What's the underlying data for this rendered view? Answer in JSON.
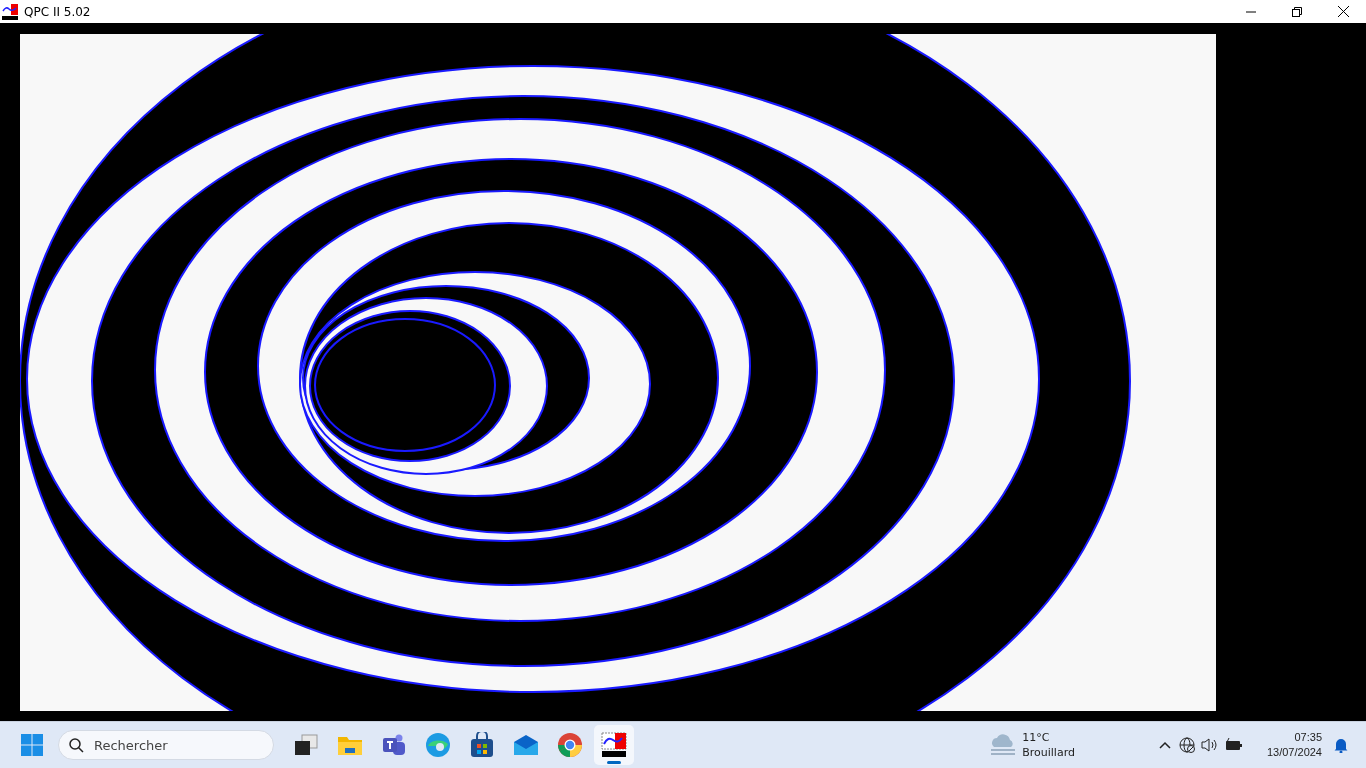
{
  "window": {
    "title": "QPC II 5.02"
  },
  "taskbar": {
    "search": {
      "placeholder": "Rechercher"
    },
    "apps": [
      {
        "kind": "taskview",
        "selected": false
      },
      {
        "kind": "folder",
        "selected": false
      },
      {
        "kind": "teams",
        "selected": false
      },
      {
        "kind": "edge",
        "selected": false
      },
      {
        "kind": "store",
        "selected": false
      },
      {
        "kind": "mail",
        "selected": false
      },
      {
        "kind": "chrome",
        "selected": false
      },
      {
        "kind": "qpc",
        "selected": true
      }
    ],
    "weather": {
      "temperature": "11°C",
      "condition": "Brouillard"
    },
    "clock": {
      "time": "07:35",
      "date": "13/07/2024"
    }
  }
}
